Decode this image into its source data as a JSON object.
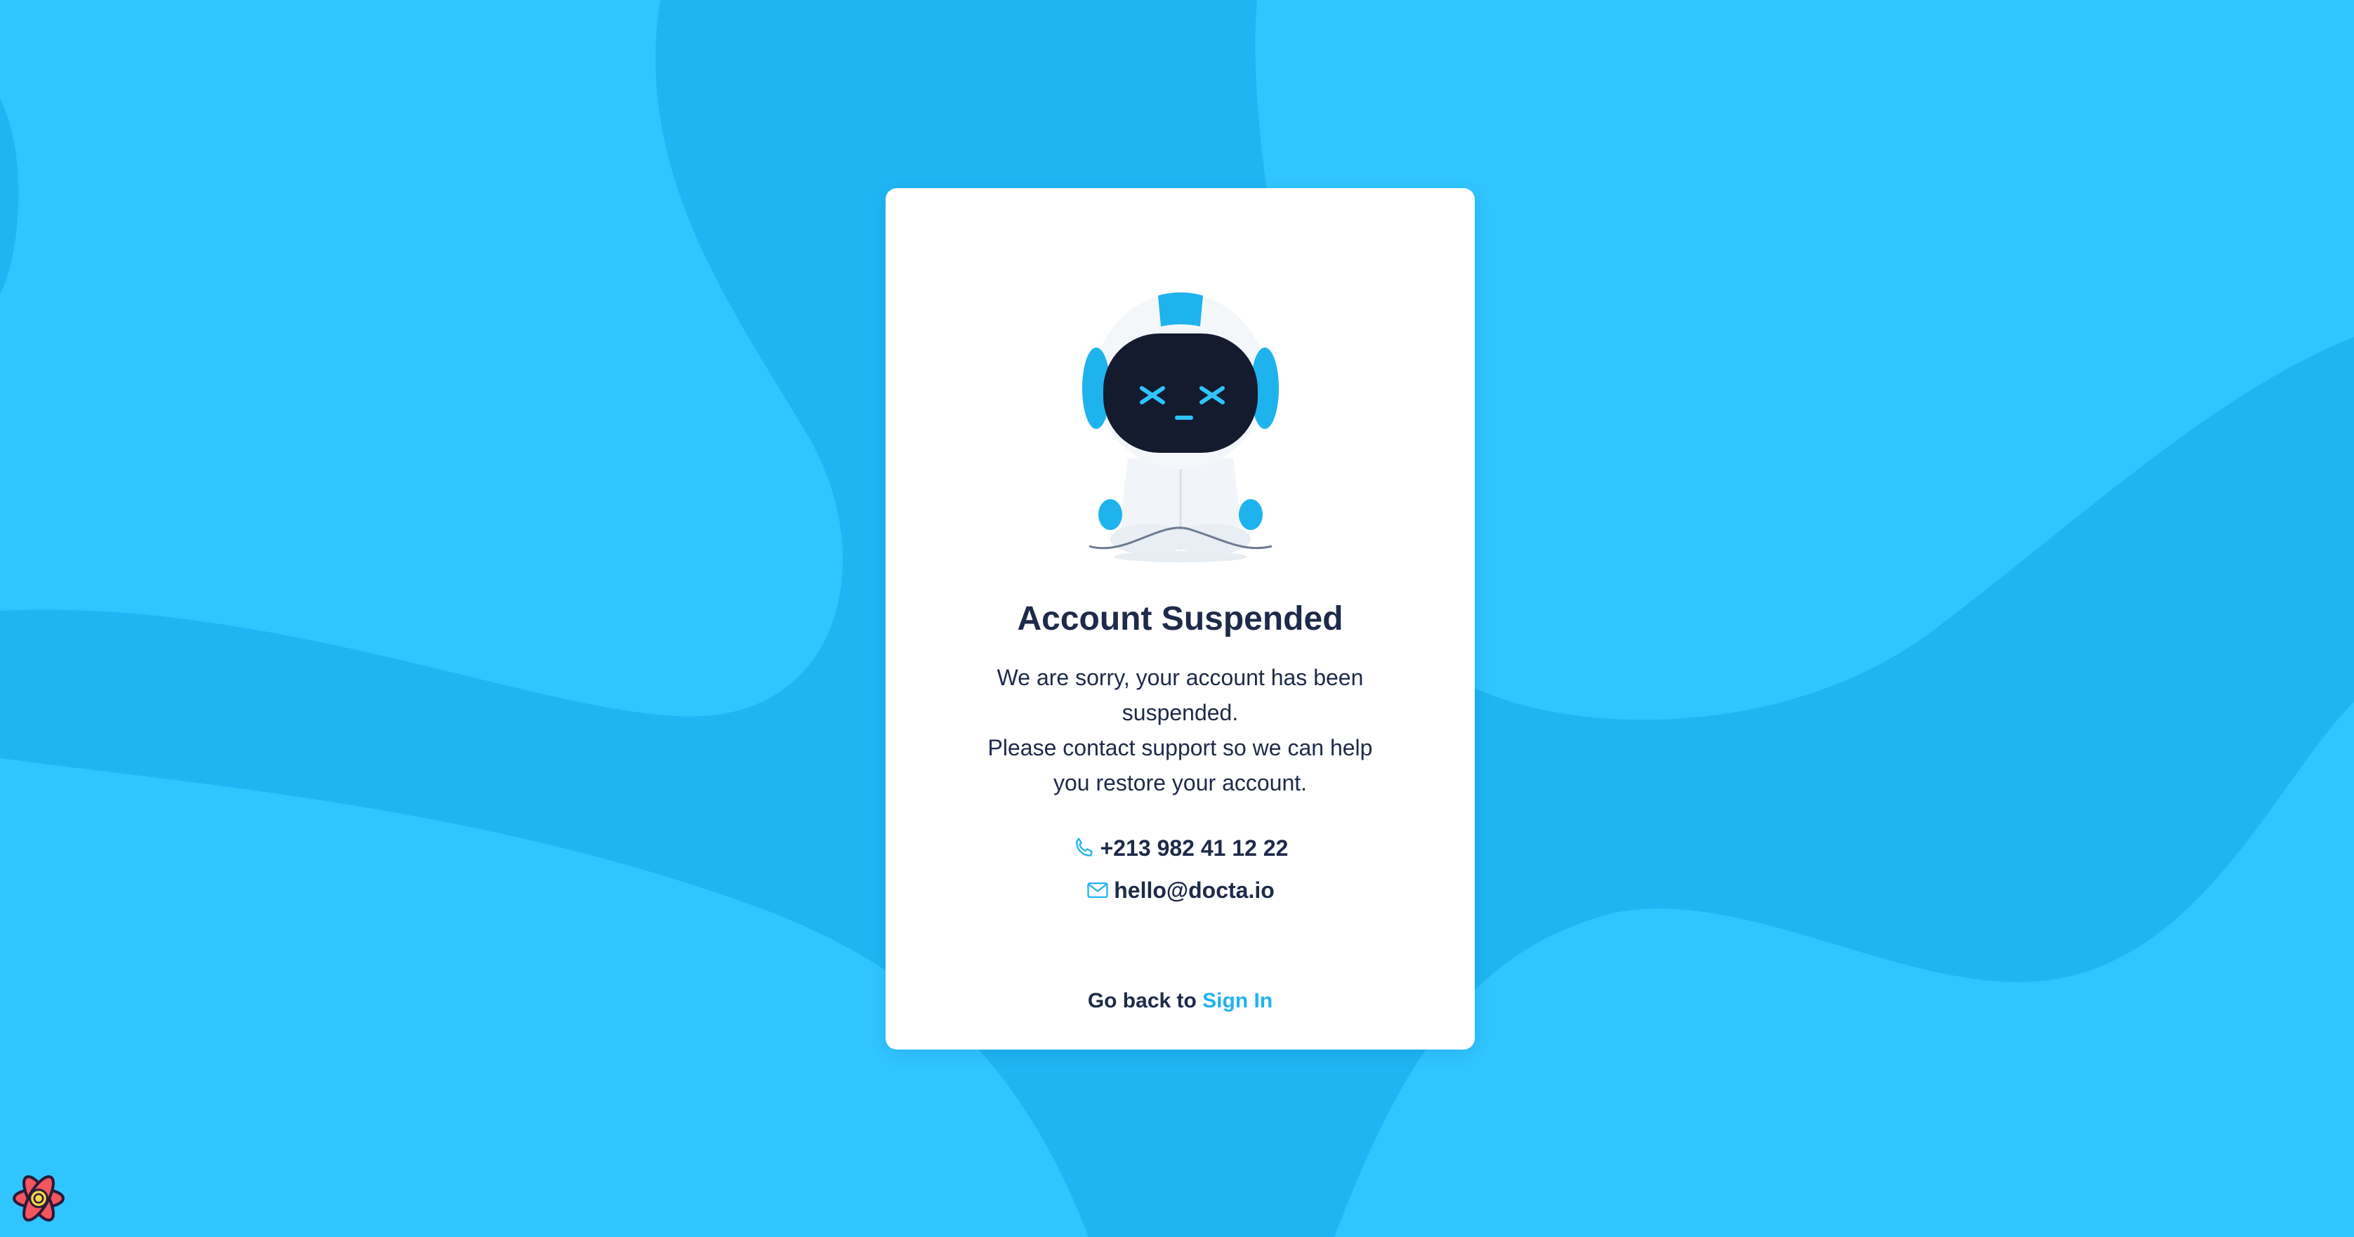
{
  "card": {
    "title": "Account Suspended",
    "message_line_1": "We are sorry, your account has been suspended.",
    "message_line_2": "Please contact support so we can help you restore your account.",
    "contact": {
      "phone": "+213 982 41 12 22",
      "email": "hello@docta.io"
    },
    "footer": {
      "prefix": "Go back to ",
      "link_label": "Sign In"
    }
  },
  "colors": {
    "background": "#2ec4ff",
    "background_dark": "#1fb5f3",
    "accent": "#1fb3ee",
    "text": "#1e2a4a",
    "card": "#ffffff"
  },
  "icons": {
    "phone": "phone-icon",
    "email": "mail-icon",
    "devtools": "react-devtools-icon",
    "illustration": "robot-illustration"
  }
}
